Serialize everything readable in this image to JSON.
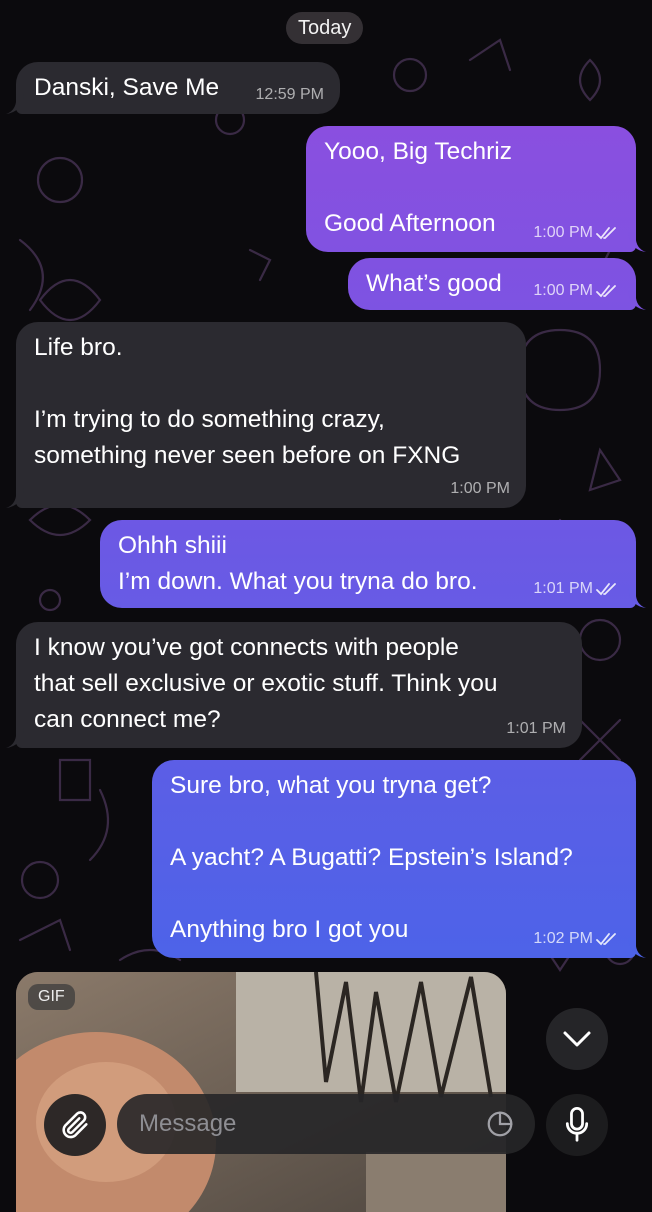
{
  "chat": {
    "date_separator": "Today",
    "messages": [
      {
        "direction": "in",
        "text": "Danski, Save Me",
        "time": "12:59 PM"
      },
      {
        "direction": "out",
        "text": "Yooo, Big Techriz\n\nGood Afternoon",
        "time": "1:00 PM",
        "read": true
      },
      {
        "direction": "out",
        "text": "What’s good",
        "time": "1:00 PM",
        "read": true
      },
      {
        "direction": "in",
        "text": "Life bro.\n\nI’m trying to do something crazy,\nsomething never seen before on FXNG",
        "time": "1:00 PM"
      },
      {
        "direction": "out",
        "text": "Ohhh shiii\nI’m down. What you tryna do bro.",
        "time": "1:01 PM",
        "read": true
      },
      {
        "direction": "in",
        "text": "I know you’ve got connects with people\nthat sell exclusive or exotic stuff. Think you\ncan connect me?",
        "time": "1:01 PM"
      },
      {
        "direction": "out",
        "text": "Sure bro, what you tryna get?\n\nA yacht? A Bugatti? Epstein’s Island?\n\nAnything bro I got you",
        "time": "1:02 PM",
        "read": true
      }
    ],
    "gif": {
      "badge": "GIF"
    }
  },
  "composer": {
    "placeholder": "Message",
    "attach_icon": "paperclip-icon",
    "sticker_icon": "sticker-icon",
    "mic_icon": "microphone-icon",
    "scroll_icon": "chevron-down-icon"
  },
  "colors": {
    "background": "#0b0a0d",
    "incoming_bubble": "#2b2a30",
    "outgoing_bubble_top": "#8a4fe0",
    "outgoing_bubble_bottom": "#4d63e8"
  }
}
